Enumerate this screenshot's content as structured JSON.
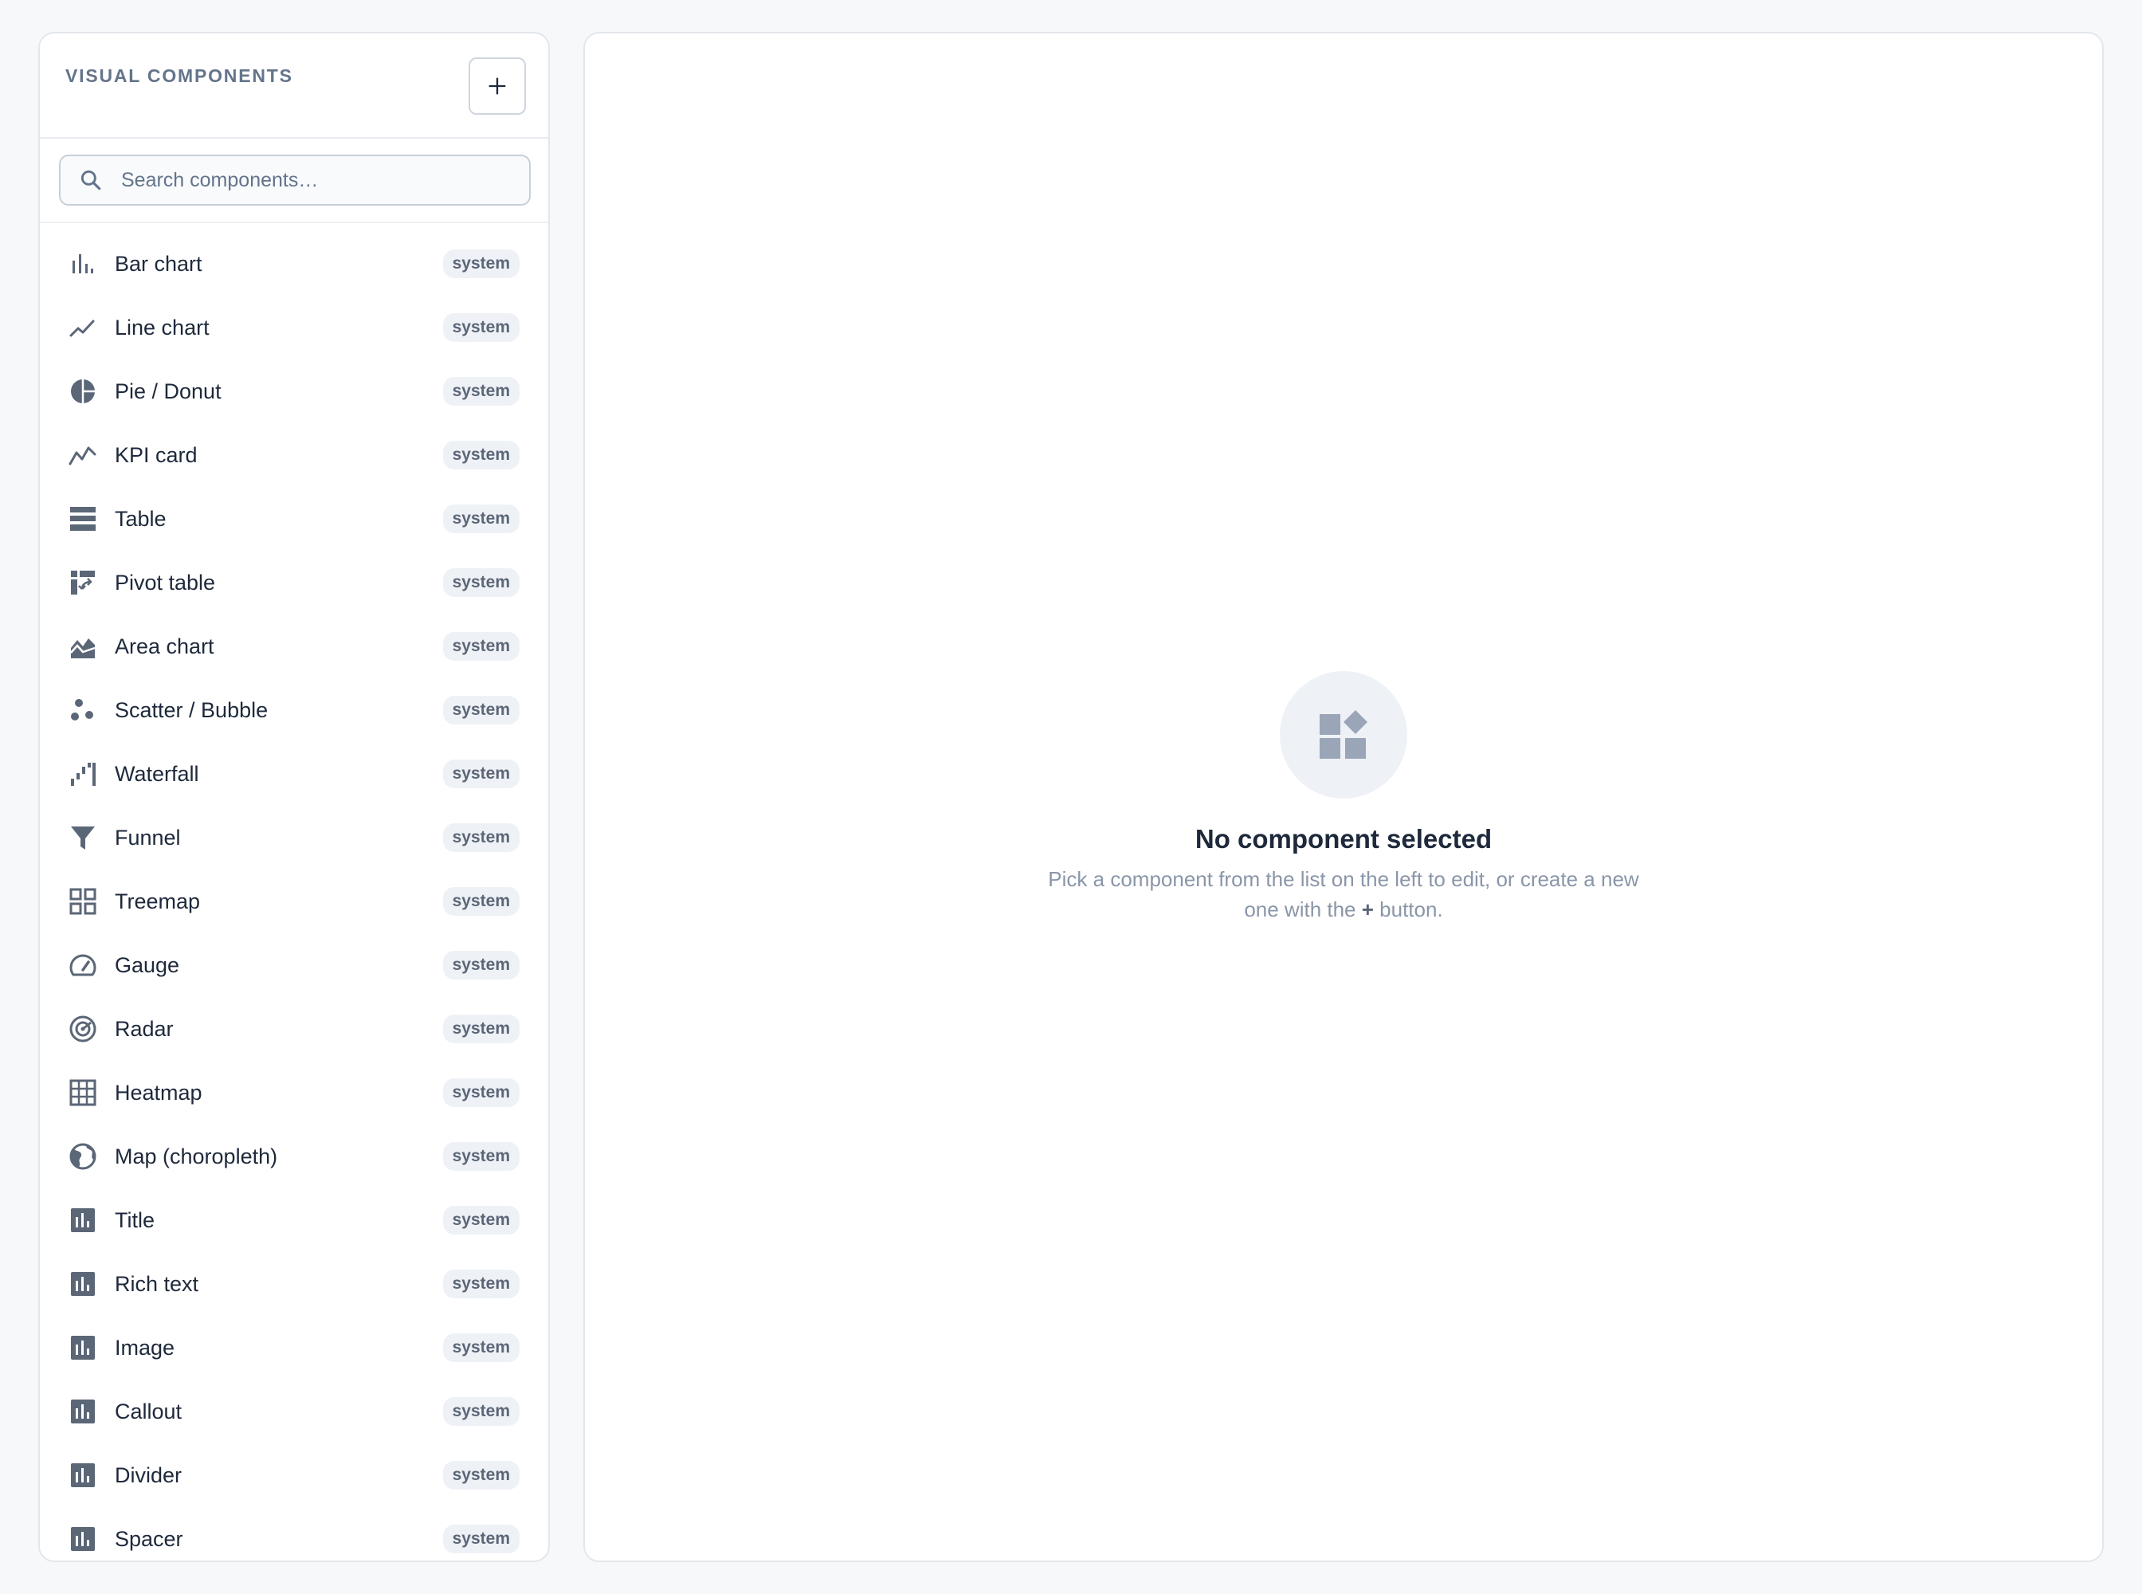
{
  "sidebar": {
    "title": "VISUAL COMPONENTS",
    "add_icon": "plus-icon",
    "search": {
      "placeholder": "Search components…",
      "value": "",
      "icon": "search-icon"
    },
    "items": [
      {
        "label": "Bar chart",
        "badge": "system",
        "icon": "bar-chart-icon"
      },
      {
        "label": "Line chart",
        "badge": "system",
        "icon": "line-chart-icon"
      },
      {
        "label": "Pie / Donut",
        "badge": "system",
        "icon": "pie-chart-icon"
      },
      {
        "label": "KPI card",
        "badge": "system",
        "icon": "trend-icon"
      },
      {
        "label": "Table",
        "badge": "system",
        "icon": "table-icon"
      },
      {
        "label": "Pivot table",
        "badge": "system",
        "icon": "pivot-table-icon"
      },
      {
        "label": "Area chart",
        "badge": "system",
        "icon": "area-chart-icon"
      },
      {
        "label": "Scatter / Bubble",
        "badge": "system",
        "icon": "scatter-icon"
      },
      {
        "label": "Waterfall",
        "badge": "system",
        "icon": "waterfall-icon"
      },
      {
        "label": "Funnel",
        "badge": "system",
        "icon": "funnel-icon"
      },
      {
        "label": "Treemap",
        "badge": "system",
        "icon": "grid-icon"
      },
      {
        "label": "Gauge",
        "badge": "system",
        "icon": "gauge-icon"
      },
      {
        "label": "Radar",
        "badge": "system",
        "icon": "radar-icon"
      },
      {
        "label": "Heatmap",
        "badge": "system",
        "icon": "heatmap-icon"
      },
      {
        "label": "Map (choropleth)",
        "badge": "system",
        "icon": "globe-icon"
      },
      {
        "label": "Title",
        "badge": "system",
        "icon": "chart-box-icon"
      },
      {
        "label": "Rich text",
        "badge": "system",
        "icon": "chart-box-icon"
      },
      {
        "label": "Image",
        "badge": "system",
        "icon": "chart-box-icon"
      },
      {
        "label": "Callout",
        "badge": "system",
        "icon": "chart-box-icon"
      },
      {
        "label": "Divider",
        "badge": "system",
        "icon": "chart-box-icon"
      },
      {
        "label": "Spacer",
        "badge": "system",
        "icon": "chart-box-icon"
      }
    ]
  },
  "main": {
    "empty_state": {
      "icon": "widgets-icon",
      "title": "No component selected",
      "description_before": "Pick a component from the list on the left to edit, or create a new one with the ",
      "description_emphasis": "+",
      "description_after": " button."
    }
  },
  "colors": {
    "icon": "#5b6677",
    "text": "#1e293b",
    "muted": "#8a96a8",
    "badge_bg": "#eef1f5",
    "empty_icon": "#9aa6b8"
  }
}
